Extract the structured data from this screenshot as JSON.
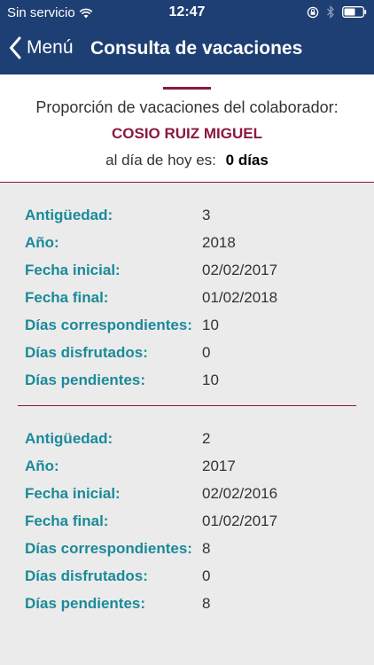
{
  "status_bar": {
    "carrier": "Sin servicio",
    "time": "12:47"
  },
  "nav": {
    "back_label": "Menú",
    "title": "Consulta de vacaciones"
  },
  "summary": {
    "caption": "Proporción de vacaciones del colaborador:",
    "employee_name": "COSIO RUIZ MIGUEL",
    "today_label": "al día de hoy es:",
    "today_value": "0 días"
  },
  "records": [
    {
      "fields": [
        {
          "label": "Antigüedad:",
          "value": "3"
        },
        {
          "label": "Año:",
          "value": "2018"
        },
        {
          "label": "Fecha inicial:",
          "value": "02/02/2017"
        },
        {
          "label": "Fecha final:",
          "value": "01/02/2018"
        },
        {
          "label": "Días correspondientes:",
          "value": "10"
        },
        {
          "label": "Días disfrutados:",
          "value": "0"
        },
        {
          "label": "Días pendientes:",
          "value": "10"
        }
      ]
    },
    {
      "fields": [
        {
          "label": "Antigüedad:",
          "value": "2"
        },
        {
          "label": "Año:",
          "value": "2017"
        },
        {
          "label": "Fecha inicial:",
          "value": "02/02/2016"
        },
        {
          "label": "Fecha final:",
          "value": "01/02/2017"
        },
        {
          "label": "Días correspondientes:",
          "value": "8"
        },
        {
          "label": "Días disfrutados:",
          "value": "0"
        },
        {
          "label": "Días pendientes:",
          "value": "8"
        }
      ]
    }
  ],
  "colors": {
    "header_bg": "#1e3f73",
    "accent": "#8b1a3c",
    "label_teal": "#1a8a9a",
    "list_bg": "#ebebeb"
  },
  "icons": {
    "wifi": "wifi-icon",
    "rotation_lock": "rotation-lock-icon",
    "bluetooth": "bluetooth-icon",
    "battery": "battery-icon",
    "back": "chevron-left-icon"
  }
}
